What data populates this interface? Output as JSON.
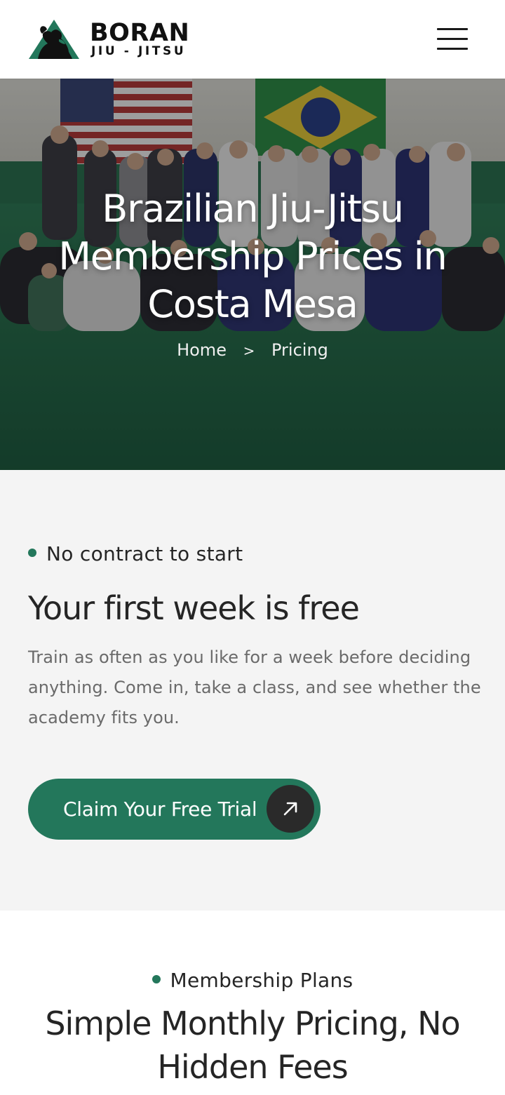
{
  "header": {
    "brand_name": "BORAN",
    "brand_sub": "JIU - JITSU",
    "menu_icon": "hamburger-menu-icon"
  },
  "hero": {
    "title": "Brazilian Jiu-Jitsu Membership Prices in Costa Mesa",
    "breadcrumb": {
      "home": "Home",
      "separator": ">",
      "current": "Pricing"
    }
  },
  "trial": {
    "eyebrow": "No contract to start",
    "title": "Your first week is free",
    "body": "Train as often as you like for a week before deciding anything. Come in, take a class, and see whether the academy fits you.",
    "cta_label": "Claim Your Free Trial",
    "cta_icon": "arrow-up-right-icon"
  },
  "plans": {
    "eyebrow": "Membership Plans",
    "title": "Simple Monthly Pricing, No Hidden Fees"
  },
  "colors": {
    "accent": "#23775b",
    "text": "#252525",
    "muted_text": "#6a6a6a",
    "section_bg": "#f4f4f4",
    "arrow_circle": "#2a2a2a"
  }
}
